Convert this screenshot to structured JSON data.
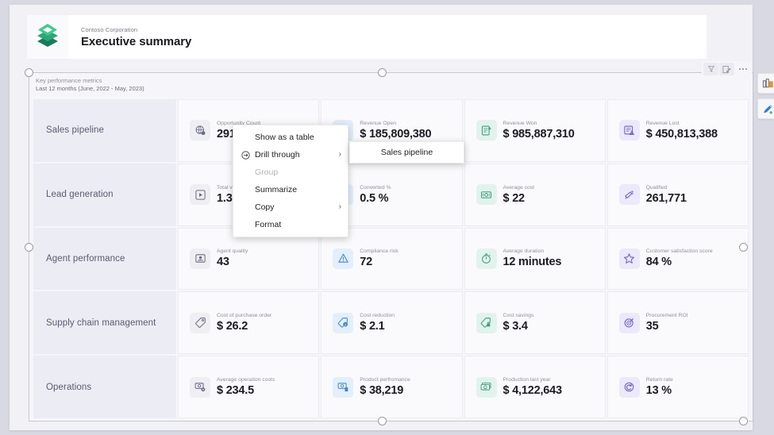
{
  "header": {
    "company": "Contoso Corporation",
    "title": "Executive summary",
    "logo_icon": "contoso-diamond-logo"
  },
  "visual_toolbar": {
    "buttons": [
      {
        "name": "filter-icon",
        "glyph": "Y"
      },
      {
        "name": "edit-visual-icon",
        "glyph": "edit"
      },
      {
        "name": "more-options-icon",
        "glyph": "..."
      }
    ]
  },
  "side_rail": {
    "buttons": [
      {
        "name": "visualizations-icon",
        "label": "Visualizations"
      },
      {
        "name": "smart-narrative-icon",
        "label": "Smart narrative"
      }
    ]
  },
  "visual": {
    "title": "Key performance metrics",
    "subtitle": "Last 12 months (June, 2022 -  May, 2023)",
    "selected": true
  },
  "grid": {
    "rows": [
      {
        "category": "Sales pipeline",
        "cells": [
          {
            "label": "Opportunity Count",
            "value": "291,68",
            "icon": "globe-opportunity-icon",
            "tint": "tint-gray"
          },
          {
            "label": "Revenue Open",
            "value": "$ 185,809,380",
            "icon": "invoice-open-icon",
            "tint": "tint-blue"
          },
          {
            "label": "Revenue Won",
            "value": "$ 985,887,310",
            "icon": "invoice-won-icon",
            "tint": "tint-green"
          },
          {
            "label": "Revenue Lost",
            "value": "$ 450,813,388",
            "icon": "invoice-lost-icon",
            "tint": "tint-purple"
          }
        ]
      },
      {
        "category": "Lead generation",
        "cells": [
          {
            "label": "Total visits",
            "value": "1.3M",
            "icon": "play-visits-icon",
            "tint": "tint-gray"
          },
          {
            "label": "Converted %",
            "value": "0.5 %",
            "icon": "converted-icon",
            "tint": "tint-blue"
          },
          {
            "label": "Average cost",
            "value": "$ 22",
            "icon": "money-cost-icon",
            "tint": "tint-green"
          },
          {
            "label": "Qualified",
            "value": "261,771",
            "icon": "megaphone-qualified-icon",
            "tint": "tint-purple"
          }
        ]
      },
      {
        "category": "Agent performance",
        "cells": [
          {
            "label": "Agent quality",
            "value": "43",
            "icon": "agent-badge-icon",
            "tint": "tint-gray"
          },
          {
            "label": "Compliance risk",
            "value": "72",
            "icon": "warning-triangle-icon",
            "tint": "tint-blue"
          },
          {
            "label": "Average duration",
            "value": "12 minutes",
            "icon": "stopwatch-icon",
            "tint": "tint-green"
          },
          {
            "label": "Customer satisfaction score",
            "value": "84 %",
            "icon": "star-icon",
            "tint": "tint-purple"
          }
        ]
      },
      {
        "category": "Supply chain management",
        "cells": [
          {
            "label": "Cost of purchase order",
            "value": "$ 26.2",
            "icon": "price-tag-icon",
            "tint": "tint-gray"
          },
          {
            "label": "Cost reduction",
            "value": "$ 2.1",
            "icon": "tag-info-icon",
            "tint": "tint-blue"
          },
          {
            "label": "Cost savings",
            "value": "$ 3.4",
            "icon": "tag-lock-icon",
            "tint": "tint-green"
          },
          {
            "label": "Procurement ROI",
            "value": "35",
            "icon": "target-roi-icon",
            "tint": "tint-purple"
          }
        ]
      },
      {
        "category": "Operations",
        "cells": [
          {
            "label": "Average operation costs",
            "value": "$ 234.5",
            "icon": "money-gear-icon",
            "tint": "tint-gray"
          },
          {
            "label": "Product perfromance",
            "value": "$ 38,219",
            "icon": "money-product-icon",
            "tint": "tint-blue"
          },
          {
            "label": "Production last year",
            "value": "$ 4,122,643",
            "icon": "money-stack-icon",
            "tint": "tint-green"
          },
          {
            "label": "Return rate",
            "value": "13 %",
            "icon": "return-arrow-icon",
            "tint": "tint-purple"
          }
        ]
      }
    ]
  },
  "context_menu": {
    "items": [
      {
        "label": "Show as a table",
        "icon": null,
        "submenu": false,
        "disabled": false
      },
      {
        "label": "Drill through",
        "icon": "drill-through-icon",
        "submenu": true,
        "disabled": false
      },
      {
        "label": "Group",
        "icon": null,
        "submenu": false,
        "disabled": true
      },
      {
        "label": "Summarize",
        "icon": null,
        "submenu": false,
        "disabled": false
      },
      {
        "label": "Copy",
        "icon": null,
        "submenu": true,
        "disabled": false
      },
      {
        "label": "Format",
        "icon": null,
        "submenu": false,
        "disabled": false
      }
    ],
    "arrow_glyph": "›"
  },
  "context_submenu": {
    "items": [
      {
        "label": "Sales pipeline"
      }
    ]
  },
  "colors": {
    "page_background": "#d9d9e3",
    "canvas": "#f1f1f6",
    "visual_background": "#f6f6fa",
    "category_cell": "#ececf4",
    "kpi_cell": "#fafafc",
    "brand_green": "#2aa87a",
    "value_text": "#1b1b23",
    "label_text": "#8f8f9c"
  }
}
